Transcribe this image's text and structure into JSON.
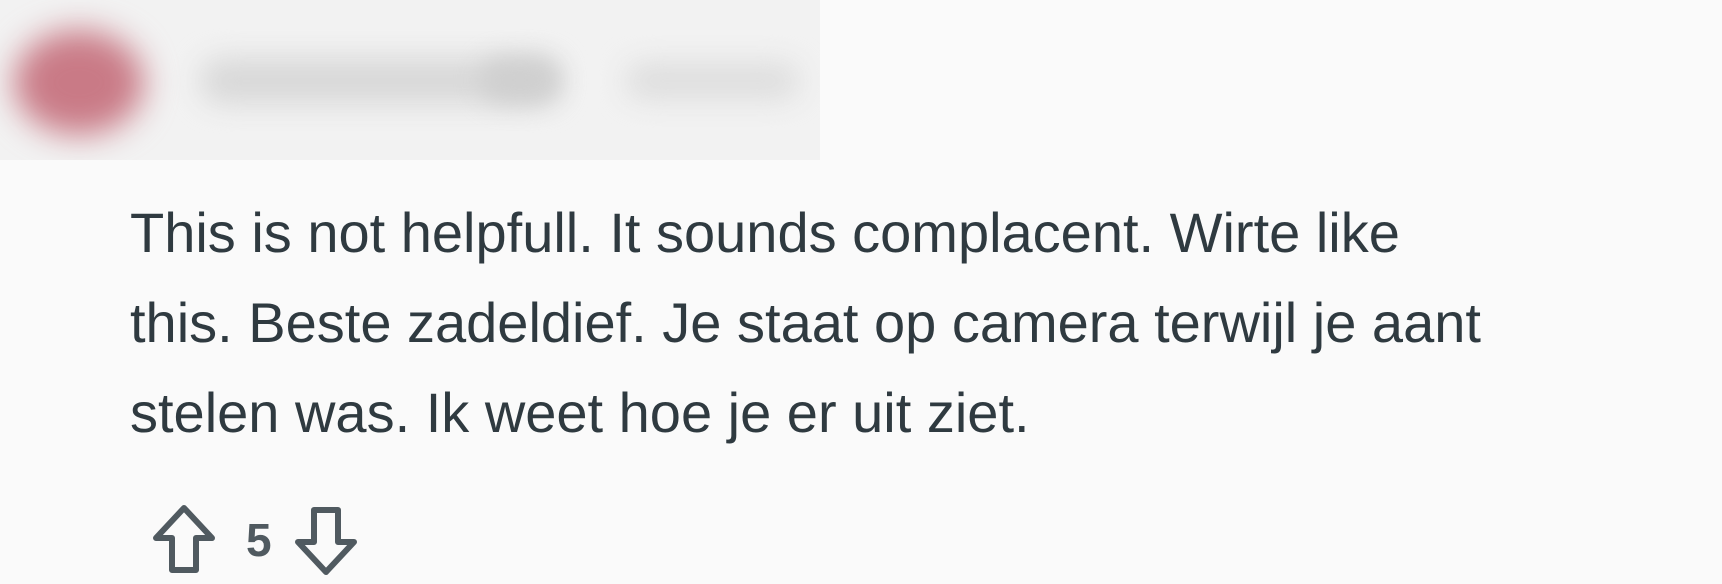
{
  "comment": {
    "lines": [
      "This is not helpfull. It sounds complacent. Wirte like",
      "this. Beste zadeldief. Je staat op camera terwijl je aant",
      "stelen was. Ik weet hoe je er uit ziet."
    ],
    "vote_count": "5"
  },
  "icons": {
    "upvote": "upvote-arrow-icon",
    "downvote": "downvote-arrow-icon"
  },
  "colors": {
    "background": "#fafafa",
    "text": "#2f3a40",
    "icon": "#505a60",
    "avatar_blur": "#c97a86"
  }
}
